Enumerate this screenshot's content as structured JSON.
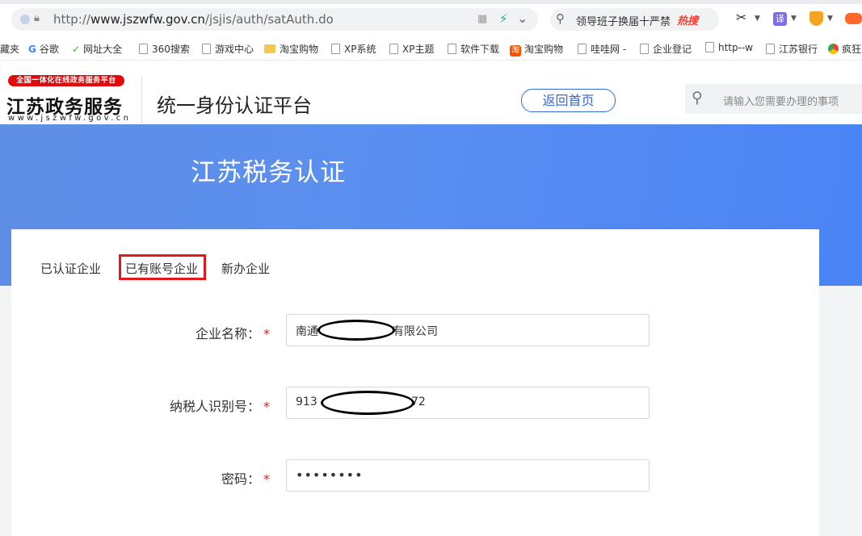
{
  "browser": {
    "url_prefix": "http://",
    "url_host": "www.jszwfw.gov.cn",
    "url_path": "/jsjis/auth/satAuth.do",
    "search_query": "领导班子换届十严禁",
    "search_hot_label": "热搜",
    "toolbar_translate": "译",
    "bookmarks": [
      "藏夹",
      "谷歌",
      "网址大全",
      "360搜索",
      "游戏中心",
      "淘宝购物",
      "XP系统",
      "XP主题",
      "软件下载",
      "淘宝购物",
      "哇哇网 -",
      "企业登记",
      "http--w",
      "江苏银行",
      "疯狂"
    ]
  },
  "site": {
    "logo_badge": "全国一体化在线政务服务平台",
    "logo_title": "江苏政务服务",
    "logo_domain": "www.jszwfw.gov.cn",
    "platform_title": "统一身份认证平台",
    "home_button": "返回首页",
    "search_placeholder": "请输入您需要办理的事项"
  },
  "banner": {
    "title": "江苏税务认证"
  },
  "tabs": [
    "已认证企业",
    "已有账号企业",
    "新办企业"
  ],
  "form": {
    "company_label": "企业名称：",
    "company_value_start": "南通",
    "company_value_end": "有限公司",
    "taxid_label": "纳税人识别号：",
    "taxid_value_start": "913",
    "taxid_value_end": "72",
    "password_label": "密码：",
    "password_value": "••••••••",
    "required_mark": "*"
  },
  "colors": {
    "accent": "#3567e0",
    "highlight_box": "#e01a1a",
    "required": "#e02020"
  }
}
